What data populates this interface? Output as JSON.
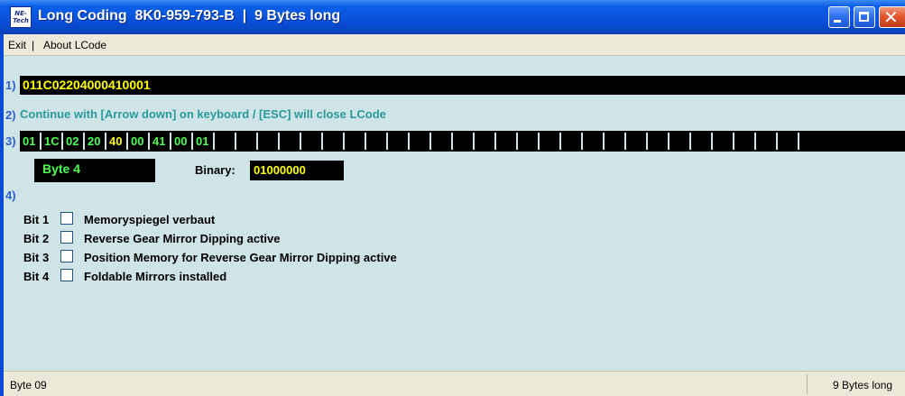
{
  "window": {
    "app_logo_text_top": "NE-",
    "app_logo_text_bottom": "Tech",
    "title": "Long Coding  8K0-959-793-B  |  9 Bytes long"
  },
  "menu": {
    "exit_label": "Exit",
    "separator": "|",
    "about_label": "About LCode"
  },
  "steps": {
    "step1_label": "1)",
    "step2_label": "2)",
    "step3_label": "3)",
    "step4_label": "4)"
  },
  "coding": {
    "long_code": "011C02204000410001",
    "instruction": "Continue with [Arrow down] on keyboard / [ESC] will close LCode",
    "bytes": [
      "01",
      "1C",
      "02",
      "20",
      "40",
      "00",
      "41",
      "00",
      "01"
    ],
    "selected_byte_index": 4,
    "empty_cell_count": 27,
    "byte_label": "Byte 4",
    "binary_caption": "Binary:",
    "binary_value": "01000000"
  },
  "bits": [
    {
      "label": "Bit 1",
      "description": "Memoryspiegel verbaut",
      "checked": false
    },
    {
      "label": "Bit 2",
      "description": "Reverse Gear Mirror Dipping active",
      "checked": false
    },
    {
      "label": "Bit 3",
      "description": "Position Memory for Reverse Gear Mirror Dipping active",
      "checked": false
    },
    {
      "label": "Bit 4",
      "description": "Foldable Mirrors installed",
      "checked": false
    }
  ],
  "status": {
    "left": "Byte 09",
    "right": "9 Bytes long"
  },
  "colors": {
    "title_bar": "#0a52dc",
    "client_background": "#cfe4e7",
    "field_background": "#000000",
    "code_text": "#ffff00",
    "byte_text": "#4cff4c",
    "instruction_text": "#2a9a9a",
    "step_number": "#2f5ed0"
  },
  "icons": {
    "minimize": "minimize-icon",
    "maximize": "maximize-icon",
    "close": "close-icon",
    "app": "ne-tech-logo-icon"
  }
}
